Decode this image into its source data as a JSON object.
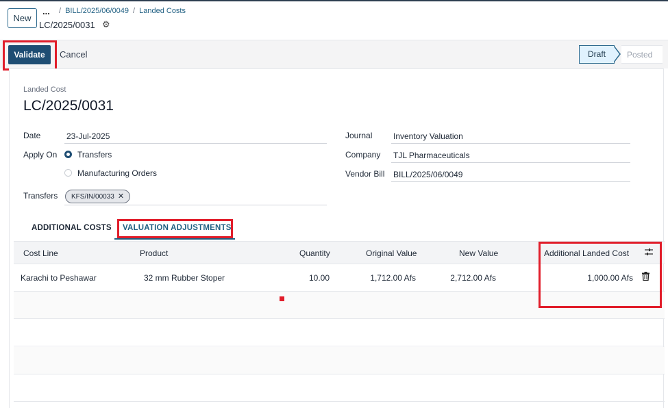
{
  "control_panel": {
    "new_label": "New",
    "breadcrumb_dots": "...",
    "breadcrumb": [
      "BILL/2025/06/0049",
      "Landed Costs"
    ],
    "breadcrumb_sep": "/",
    "record_name": "LC/2025/0031"
  },
  "statusbar": {
    "validate_label": "Validate",
    "cancel_label": "Cancel",
    "stages": [
      "Draft",
      "Posted"
    ],
    "active_stage": "Draft"
  },
  "form": {
    "small_label": "Landed Cost",
    "title": "LC/2025/0031",
    "date_label": "Date",
    "date_value": "23-Jul-2025",
    "apply_on_label": "Apply On",
    "apply_on_options": [
      "Transfers",
      "Manufacturing Orders"
    ],
    "apply_on_selected": "Transfers",
    "transfers_label": "Transfers",
    "transfers_tags": [
      "KFS/IN/00033"
    ],
    "journal_label": "Journal",
    "journal_value": "Inventory Valuation",
    "company_label": "Company",
    "company_value": "TJL Pharmaceuticals",
    "vendor_bill_label": "Vendor Bill",
    "vendor_bill_value": "BILL/2025/06/0049"
  },
  "tabs": [
    "ADDITIONAL COSTS",
    "VALUATION ADJUSTMENTS"
  ],
  "active_tab": "VALUATION ADJUSTMENTS",
  "table": {
    "columns": [
      "Cost Line",
      "Product",
      "Quantity",
      "Original Value",
      "New Value",
      "Additional Landed Cost"
    ],
    "rows": [
      {
        "cost_line": "Karachi to Peshawar",
        "product": "32 mm Rubber Stoper",
        "quantity": "10.00",
        "original_value": "1,712.00 Afs",
        "new_value": "2,712.00 Afs",
        "additional_landed_cost": "1,000.00 Afs"
      }
    ]
  },
  "colors": {
    "primary": "#1e4d73",
    "link": "#1f5f82",
    "highlight": "#e11d2a"
  }
}
